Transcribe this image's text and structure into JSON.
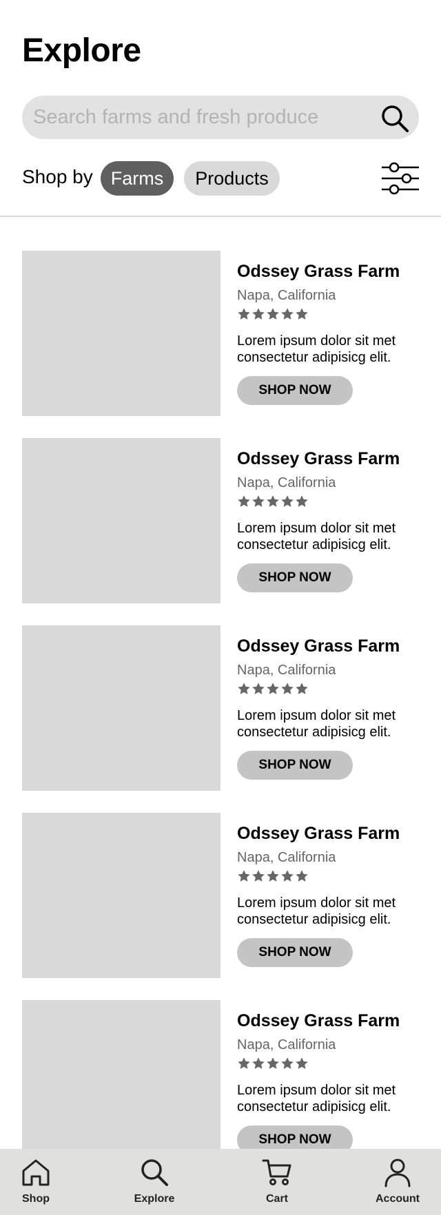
{
  "header": {
    "title": "Explore"
  },
  "search": {
    "placeholder": "Search farms and fresh produce",
    "value": ""
  },
  "shop_by": {
    "label": "Shop by",
    "options": [
      {
        "label": "Farms",
        "selected": true
      },
      {
        "label": "Products",
        "selected": false
      }
    ]
  },
  "icons": {
    "search": "search-icon",
    "filter": "sliders-icon",
    "star": "star-icon",
    "nav_shop": "home-icon",
    "nav_explore": "search-icon",
    "nav_cart": "cart-icon",
    "nav_account": "user-icon"
  },
  "colors": {
    "chip_selected": "#5f5f5f",
    "chip_unselected": "#d9d9d9",
    "search_bg": "#e2e2e2",
    "image_placeholder": "#d9d9d9",
    "button_bg": "#c4c4c4",
    "star": "#666666",
    "nav_bg": "#e0e0de"
  },
  "farms": [
    {
      "name": "Odssey Grass Farm",
      "location": "Napa, California",
      "rating": 5,
      "description": "Lorem ipsum dolor sit met consectetur adipisicg elit.",
      "button": "SHOP NOW"
    },
    {
      "name": "Odssey Grass Farm",
      "location": "Napa, California",
      "rating": 5,
      "description": "Lorem ipsum dolor sit met consectetur adipisicg elit.",
      "button": "SHOP NOW"
    },
    {
      "name": "Odssey Grass Farm",
      "location": "Napa, California",
      "rating": 5,
      "description": "Lorem ipsum dolor sit met consectetur adipisicg elit.",
      "button": "SHOP NOW"
    },
    {
      "name": "Odssey Grass Farm",
      "location": "Napa, California",
      "rating": 5,
      "description": "Lorem ipsum dolor sit met consectetur adipisicg elit.",
      "button": "SHOP NOW"
    },
    {
      "name": "Odssey Grass Farm",
      "location": "Napa, California",
      "rating": 5,
      "description": "Lorem ipsum dolor sit met consectetur adipisicg elit.",
      "button": "SHOP NOW"
    }
  ],
  "nav": [
    {
      "label": "Shop",
      "icon": "home-icon"
    },
    {
      "label": "Explore",
      "icon": "search-icon"
    },
    {
      "label": "Cart",
      "icon": "cart-icon"
    },
    {
      "label": "Account",
      "icon": "user-icon"
    }
  ]
}
